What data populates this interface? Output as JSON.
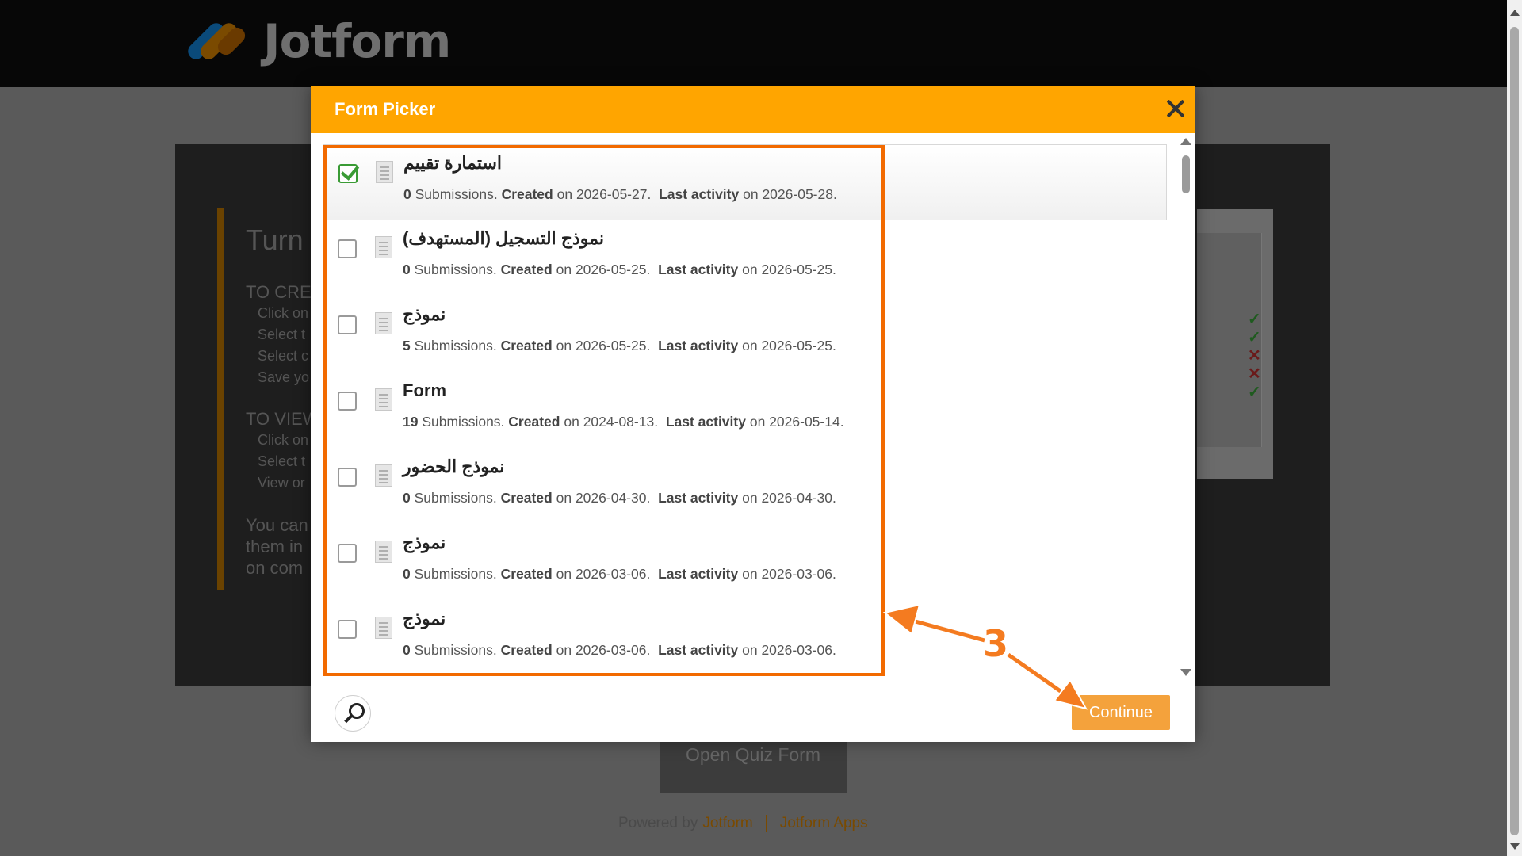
{
  "app": {
    "logo_text": "Jotform"
  },
  "background": {
    "title": "Turn",
    "create_heading": "TO CREATE",
    "create_items": [
      "Click on",
      "Select t",
      "Select c",
      "Save yo"
    ],
    "view_heading": "TO VIEW",
    "view_items": [
      "Click on",
      "Select t",
      "View or"
    ],
    "paragraph": [
      "You can",
      "them in",
      "on com"
    ],
    "open_button": "Open Quiz Form",
    "footer_powered": "Powered by",
    "footer_link1": "Jotform",
    "footer_link2": "Jotform Apps"
  },
  "modal": {
    "title": "Form Picker",
    "continue_label": "Continue",
    "forms": [
      {
        "name": "استمارة تقييم",
        "submissions": "0",
        "created": "2026-05-27",
        "last_activity": "2026-05-28",
        "checked": true
      },
      {
        "name": "نموذج التسجيل (المستهدف)",
        "submissions": "0",
        "created": "2026-05-25",
        "last_activity": "2026-05-25",
        "checked": false
      },
      {
        "name": "نموذج",
        "submissions": "5",
        "created": "2026-05-25",
        "last_activity": "2026-05-25",
        "checked": false
      },
      {
        "name": "Form",
        "submissions": "19",
        "created": "2024-08-13",
        "last_activity": "2026-05-14",
        "checked": false
      },
      {
        "name": "نموذج الحضور",
        "submissions": "0",
        "created": "2026-04-30",
        "last_activity": "2026-04-30",
        "checked": false
      },
      {
        "name": "نموذج",
        "submissions": "0",
        "created": "2026-03-06",
        "last_activity": "2026-03-06",
        "checked": false
      },
      {
        "name": "نموذج",
        "submissions": "0",
        "created": "2026-03-06",
        "last_activity": "2026-03-06",
        "checked": false
      }
    ],
    "meta_labels": {
      "submissions": "Submissions.",
      "created": "Created",
      "on": "on",
      "last_activity": "Last activity"
    }
  },
  "annotation": {
    "step": "3"
  },
  "colors": {
    "header": "#ffa500",
    "accent": "#f26a00",
    "continue": "#f4a23c",
    "check": "#3a9b35"
  }
}
